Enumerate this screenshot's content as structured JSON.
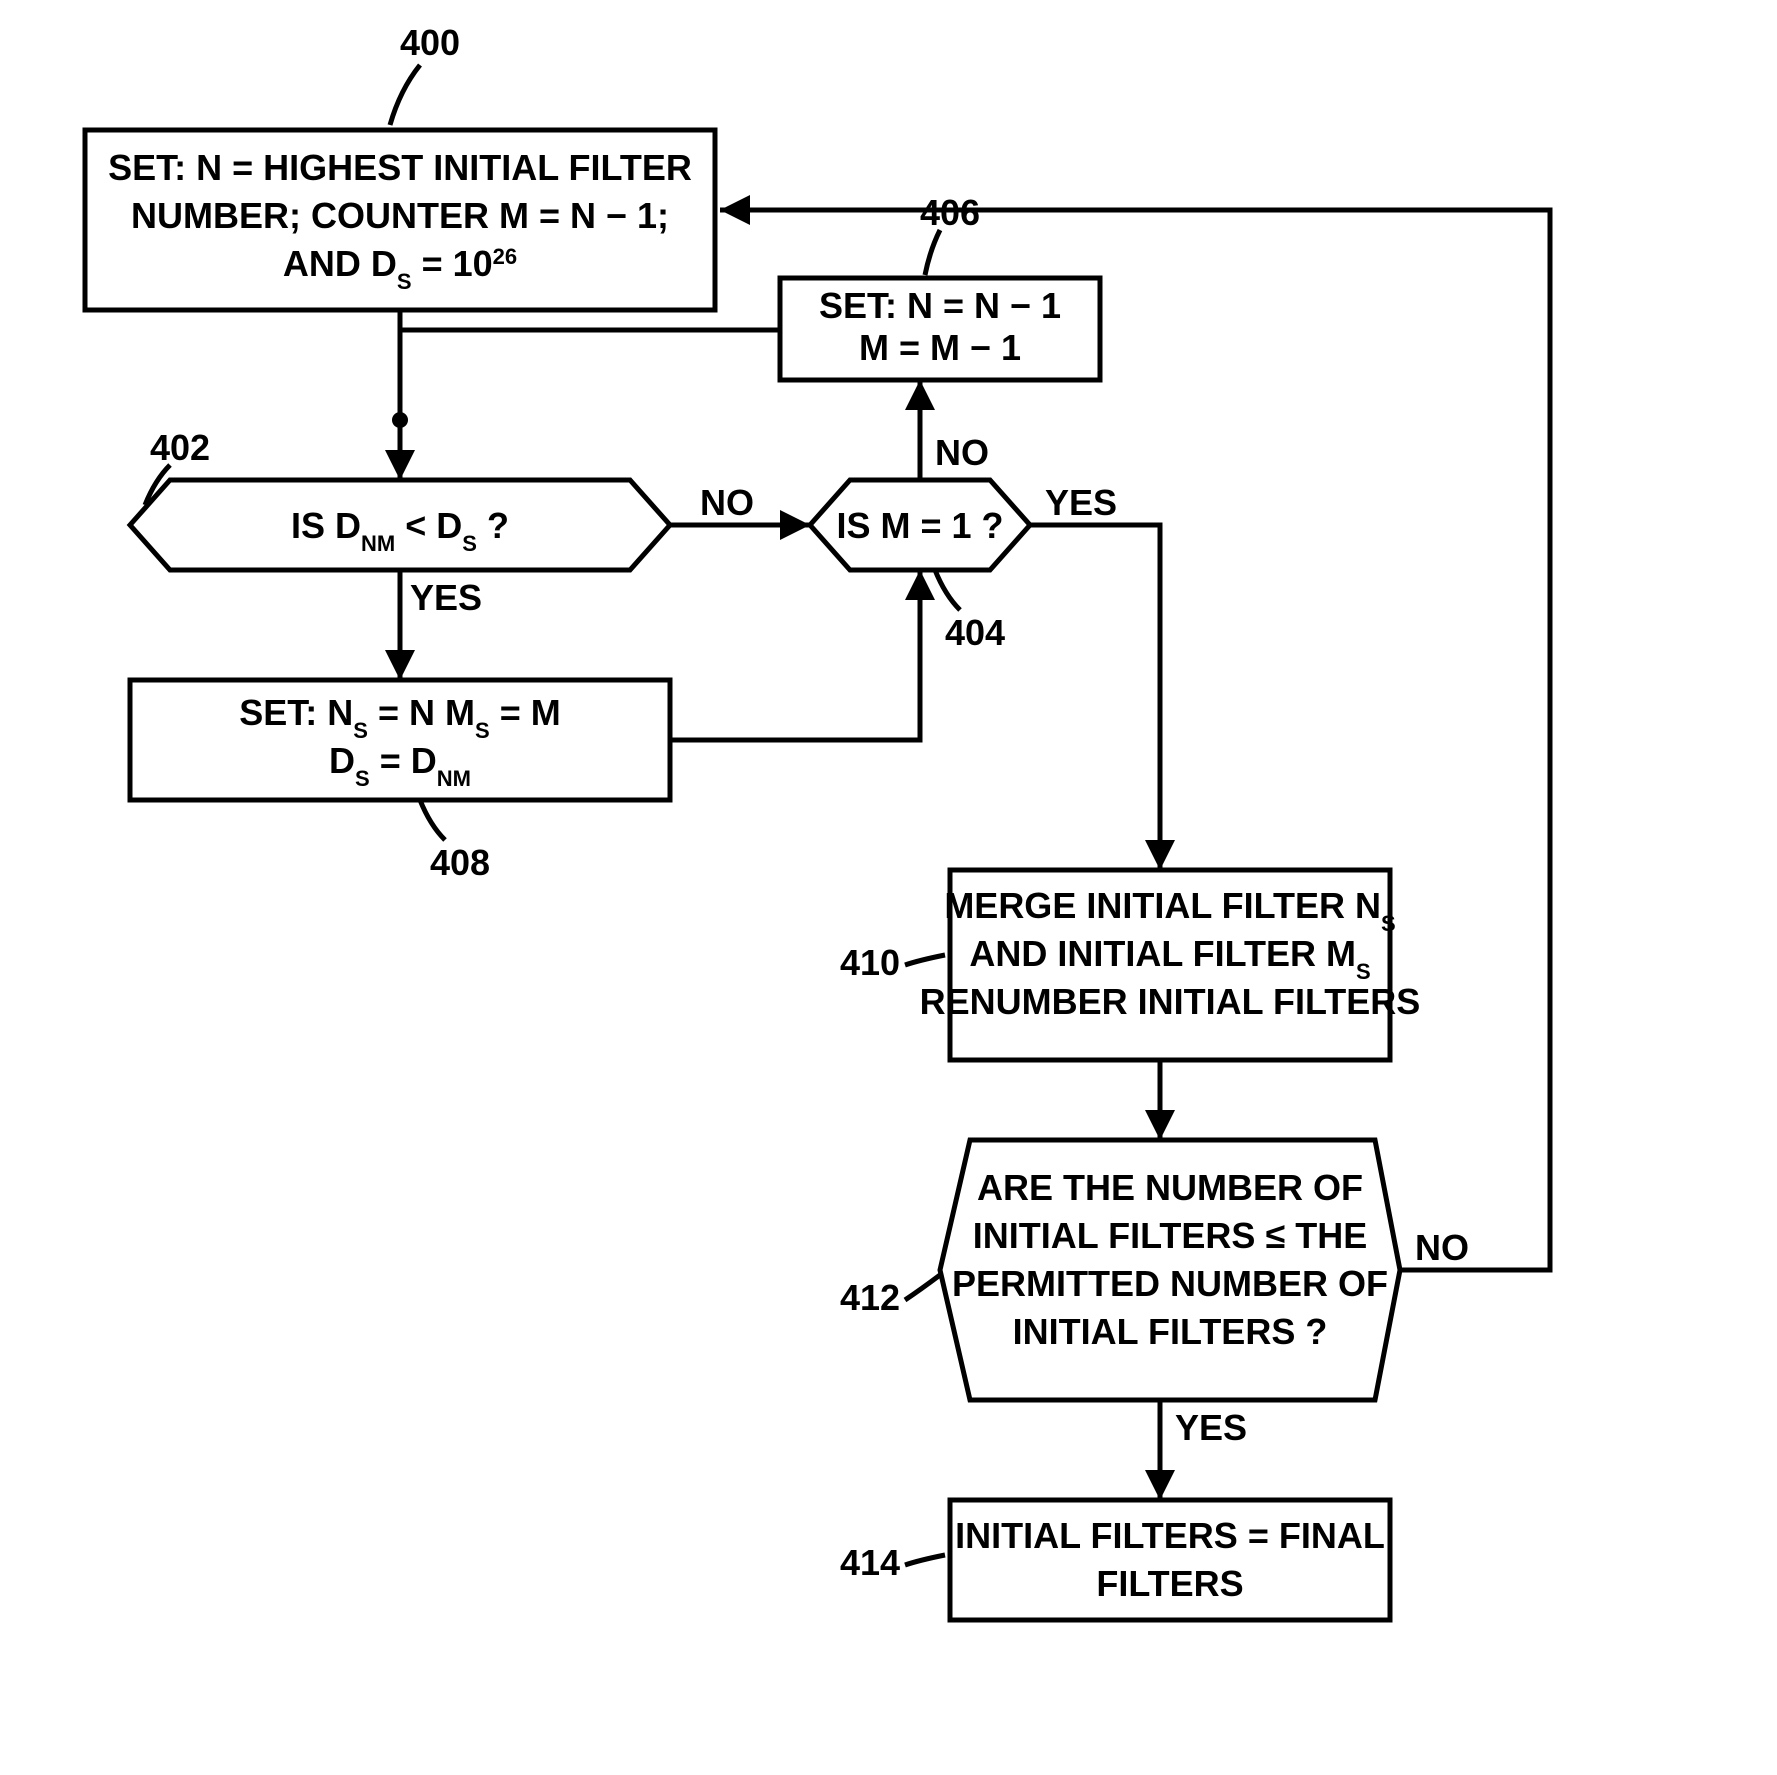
{
  "refs": {
    "n400": "400",
    "n402": "402",
    "n404": "404",
    "n406": "406",
    "n408": "408",
    "n410": "410",
    "n412": "412",
    "n414": "414"
  },
  "labels": {
    "yes": "YES",
    "no": "NO"
  },
  "blocks": {
    "b400": {
      "l1a": "SET: N = HIGHEST INITIAL FILTER",
      "l2a": "NUMBER; COUNTER M = N − 1;",
      "l3a": "AND D",
      "l3s": "S",
      "l3b": " = 10",
      "l3p": "26"
    },
    "b406": {
      "l1": "SET: N = N − 1",
      "l2": "M = M − 1"
    },
    "b402": {
      "pre": "IS D",
      "sub1": "NM",
      "mid": " < D",
      "sub2": "S",
      "post": " ?"
    },
    "b404": {
      "text": "IS M = 1 ?"
    },
    "b408": {
      "l1a": "SET: N",
      "l1s1": "S",
      "l1b": " = N   M",
      "l1s2": "S",
      "l1c": " = M",
      "l2a": "D",
      "l2s1": "S",
      "l2b": " = D",
      "l2s2": "NM"
    },
    "b410": {
      "l1a": "MERGE INITIAL FILTER N",
      "l1s": "S",
      "l2a": "AND INITIAL FILTER M",
      "l2s": "S",
      "l3": "RENUMBER INITIAL FILTERS"
    },
    "b412": {
      "l1": "ARE THE NUMBER OF",
      "l2": "INITIAL FILTERS ≤ THE",
      "l3": "PERMITTED NUMBER OF",
      "l4": "INITIAL FILTERS ?"
    },
    "b414": {
      "l1": "INITIAL FILTERS = FINAL",
      "l2": "FILTERS"
    }
  }
}
